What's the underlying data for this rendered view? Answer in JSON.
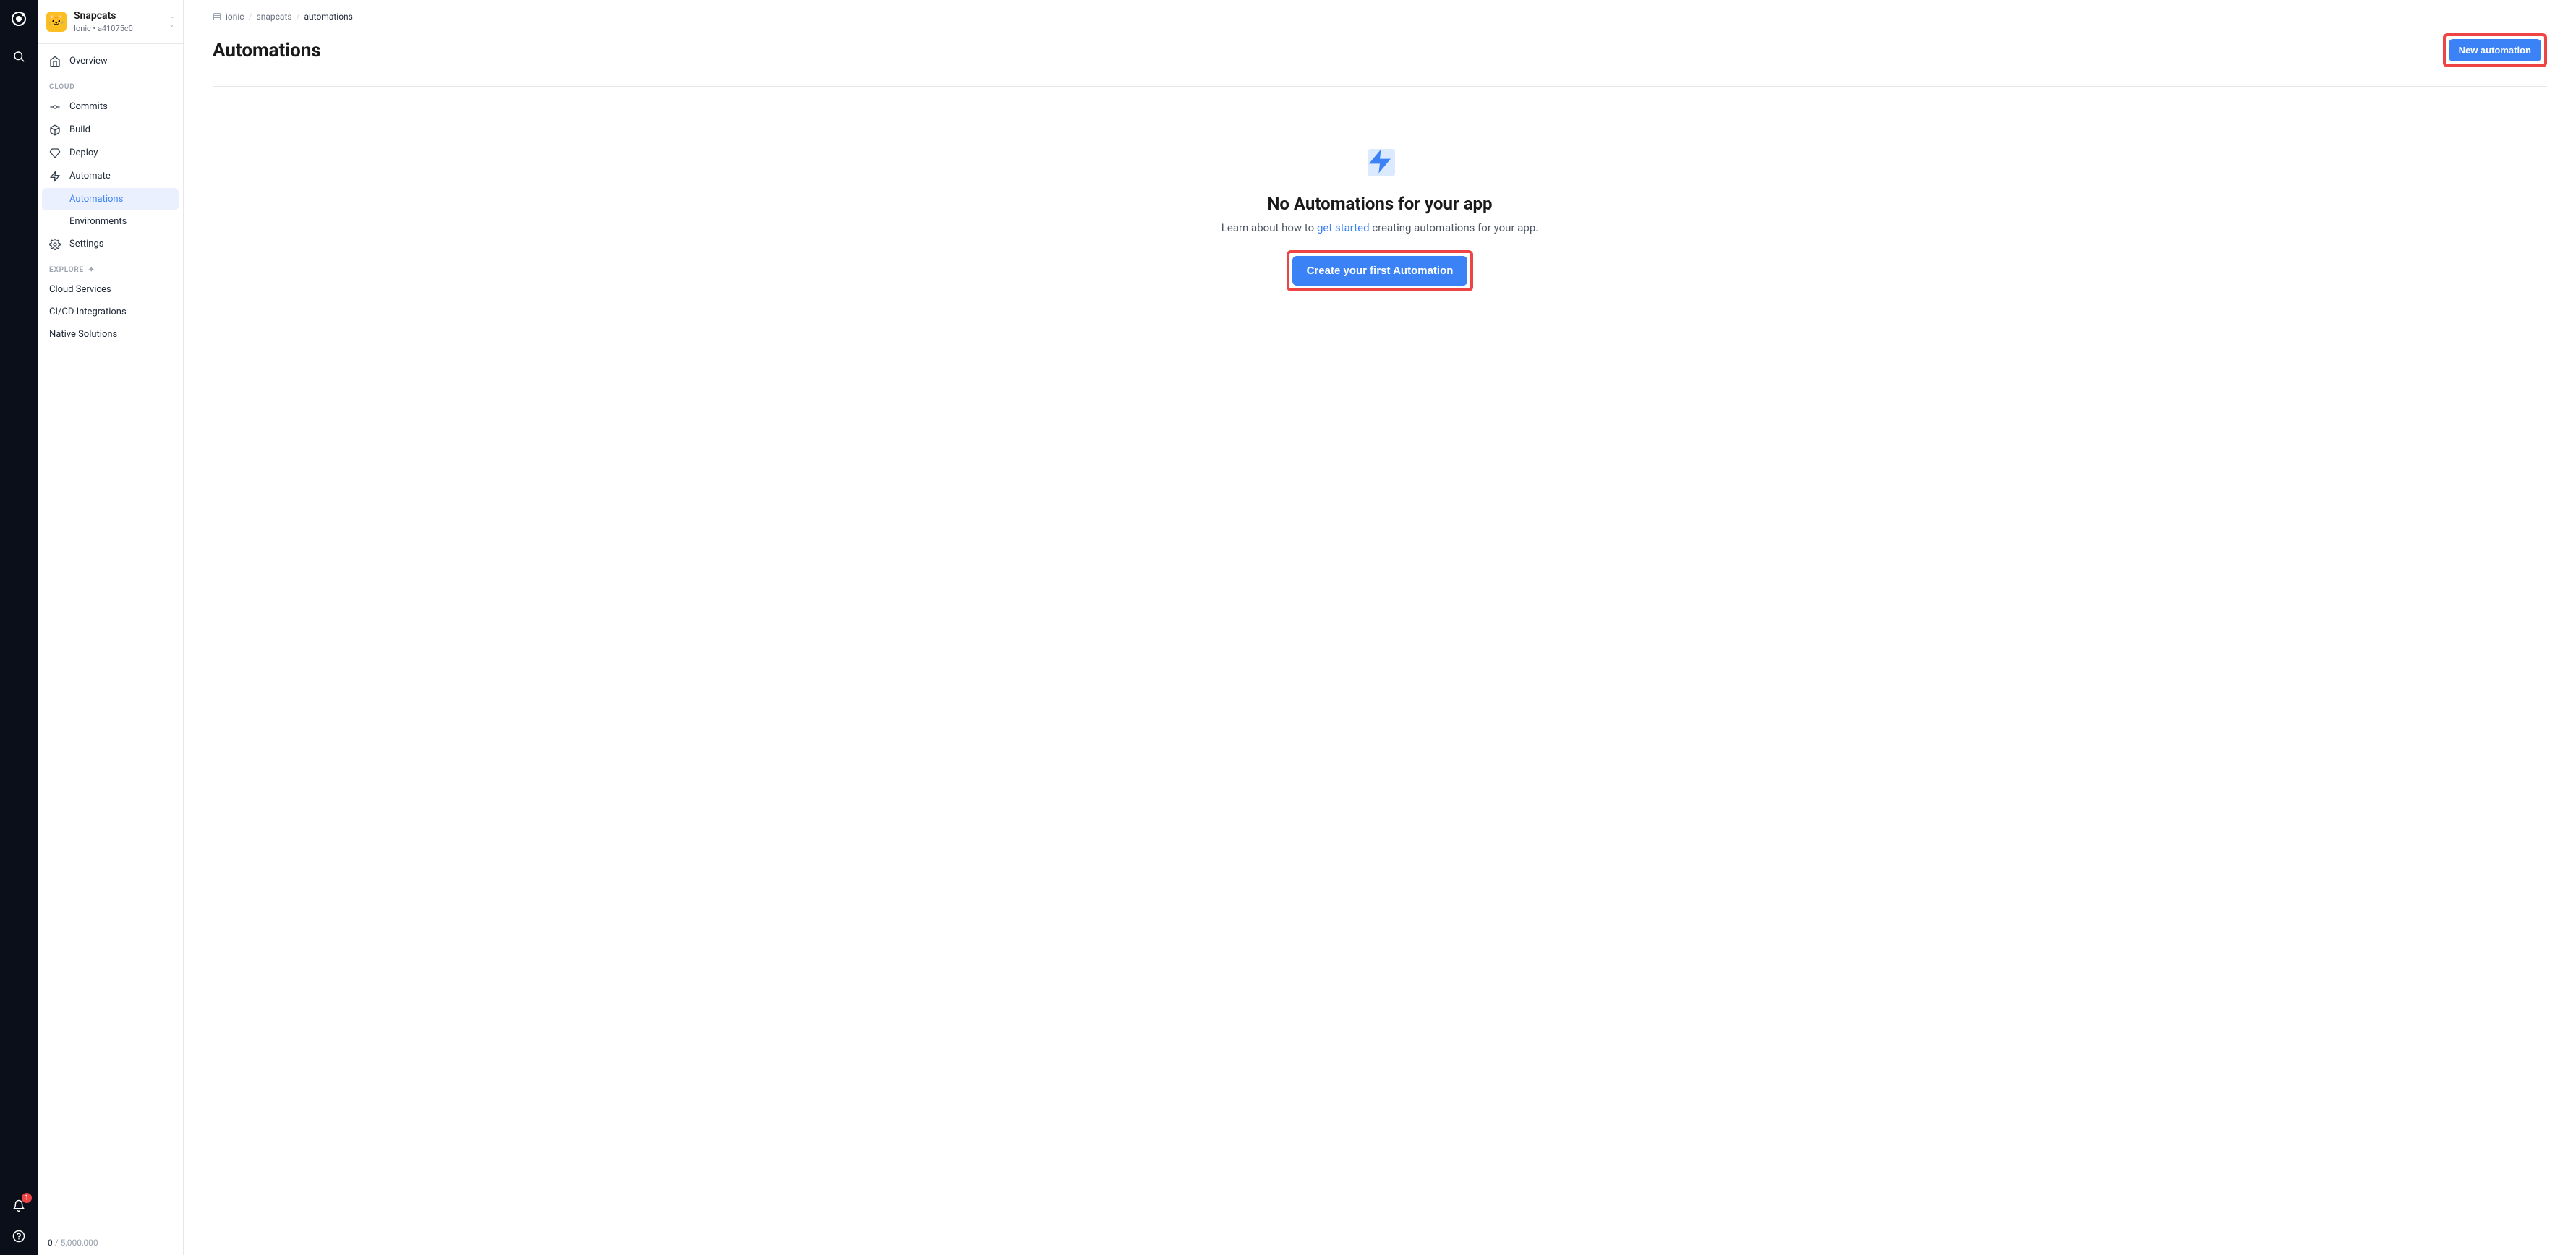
{
  "rail": {
    "notification_count": "1"
  },
  "project": {
    "name": "Snapcats",
    "org": "Ionic",
    "app_id": "a41075c0",
    "avatar_emoji": "🐱"
  },
  "sidebar": {
    "overview": "Overview",
    "section_cloud": "CLOUD",
    "commits": "Commits",
    "build": "Build",
    "deploy": "Deploy",
    "automate": "Automate",
    "automations": "Automations",
    "environments": "Environments",
    "settings": "Settings",
    "section_explore": "EXPLORE",
    "cloud_services": "Cloud Services",
    "cicd": "CI/CD Integrations",
    "native": "Native Solutions",
    "usage_current": "0",
    "usage_limit": "5,000,000"
  },
  "breadcrumb": {
    "org": "ionic",
    "app": "snapcats",
    "page": "automations"
  },
  "header": {
    "title": "Automations",
    "new_button": "New automation"
  },
  "empty": {
    "title": "No Automations for your app",
    "sub_pre": "Learn about how to ",
    "sub_link": "get started",
    "sub_post": " creating automations for your app.",
    "cta": "Create your first Automation"
  }
}
